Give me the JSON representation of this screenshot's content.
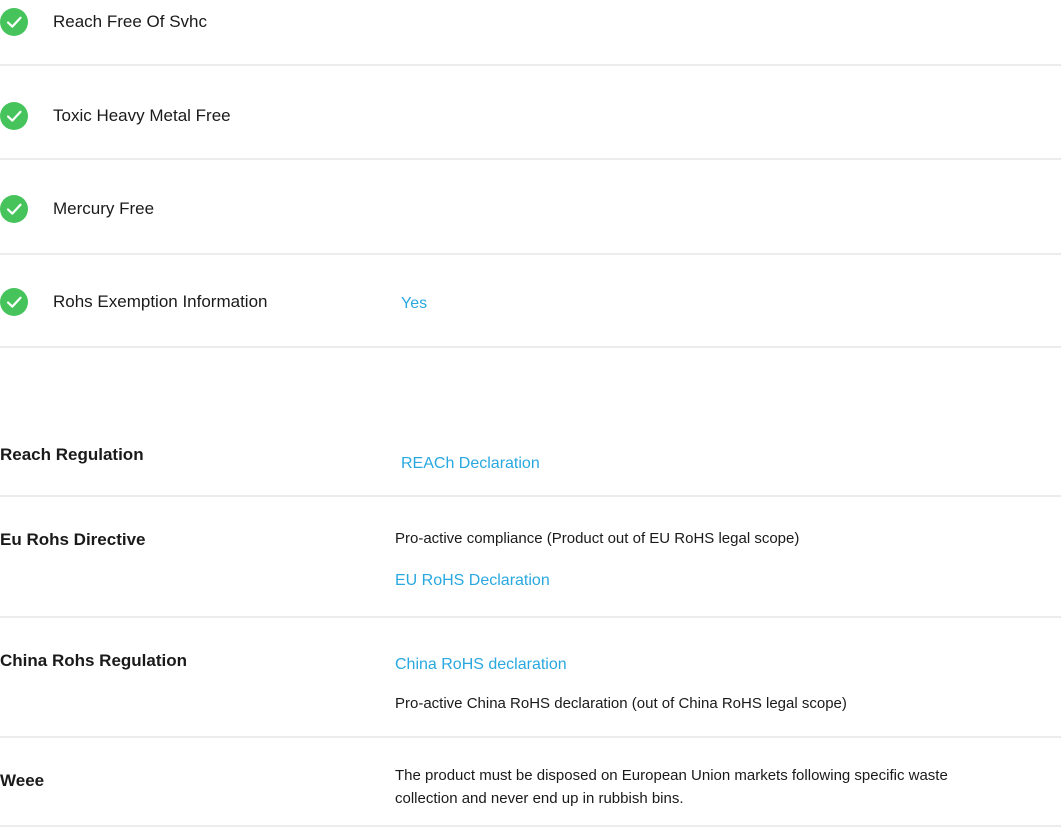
{
  "compliance_checks": [
    {
      "label": "Reach Free Of Svhc",
      "icon": "check-circle-icon",
      "value": ""
    },
    {
      "label": "Toxic Heavy Metal Free",
      "icon": "check-circle-icon",
      "value": ""
    },
    {
      "label": "Mercury Free",
      "icon": "check-circle-icon",
      "value": ""
    },
    {
      "label": "Rohs Exemption Information",
      "icon": "check-circle-icon",
      "value": "Yes"
    }
  ],
  "regulations": [
    {
      "title": "Reach Regulation",
      "link": "REACh Declaration"
    },
    {
      "title": "Eu Rohs Directive",
      "text": "Pro-active compliance (Product out of EU RoHS legal scope)",
      "link": "EU RoHS Declaration"
    },
    {
      "title": "China Rohs Regulation",
      "link": "China RoHS declaration",
      "text": "Pro-active China RoHS declaration (out of China RoHS legal scope)"
    },
    {
      "title": "Weee",
      "text_line1": "The product must be disposed on European Union markets following specific waste",
      "text_line2": "collection and never end up in rubbish bins."
    }
  ],
  "colors": {
    "check_green": "#46c45b",
    "link_blue": "#29a8e0",
    "divider": "#ececec",
    "text": "#1a1a1a"
  }
}
